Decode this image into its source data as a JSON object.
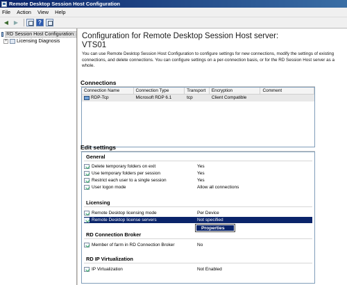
{
  "window": {
    "title": "Remote Desktop Session Host Configuration"
  },
  "menu": [
    "File",
    "Action",
    "View",
    "Help"
  ],
  "tree": {
    "root": "RD Session Host Configuration:",
    "children": [
      "Licensing Diagnosis"
    ]
  },
  "main": {
    "heading": "Configuration for Remote Desktop Session Host server:",
    "server_name": "VTS01",
    "intro": "You can use Remote Desktop Session Host Configuration to configure settings for new connections, modify the settings of existing connections, and delete connections. You can configure settings on a per-connection basis, or for the RD Session Host server as a whole."
  },
  "connections": {
    "label": "Connections",
    "columns": [
      "Connection Name",
      "Connection Type",
      "Transport",
      "Encryption",
      "Comment"
    ],
    "rows": [
      [
        "RDP-Tcp",
        "Microsoft RDP 6.1",
        "tcp",
        "Client Compatible",
        ""
      ]
    ]
  },
  "edit_settings": {
    "label": "Edit settings",
    "groups": [
      {
        "name": "General",
        "items": [
          {
            "name": "Delete temporary folders on exit",
            "value": "Yes"
          },
          {
            "name": "Use temporary folders per session",
            "value": "Yes"
          },
          {
            "name": "Restrict each user to a single session",
            "value": "Yes"
          },
          {
            "name": "User logon mode",
            "value": "Allow all connections"
          }
        ]
      },
      {
        "name": "Licensing",
        "items": [
          {
            "name": "Remote Desktop licensing mode",
            "value": "Per Device"
          },
          {
            "name": "Remote Desktop license servers",
            "value": "Not specified"
          }
        ]
      },
      {
        "name": "RD Connection Broker",
        "items": [
          {
            "name": "Member of farm in RD Connection Broker",
            "value": "No"
          }
        ]
      },
      {
        "name": "RD IP Virtualization",
        "items": [
          {
            "name": "IP Virtualization",
            "value": "Not Enabled"
          }
        ]
      }
    ]
  },
  "context_menu": {
    "item": "Properties"
  }
}
